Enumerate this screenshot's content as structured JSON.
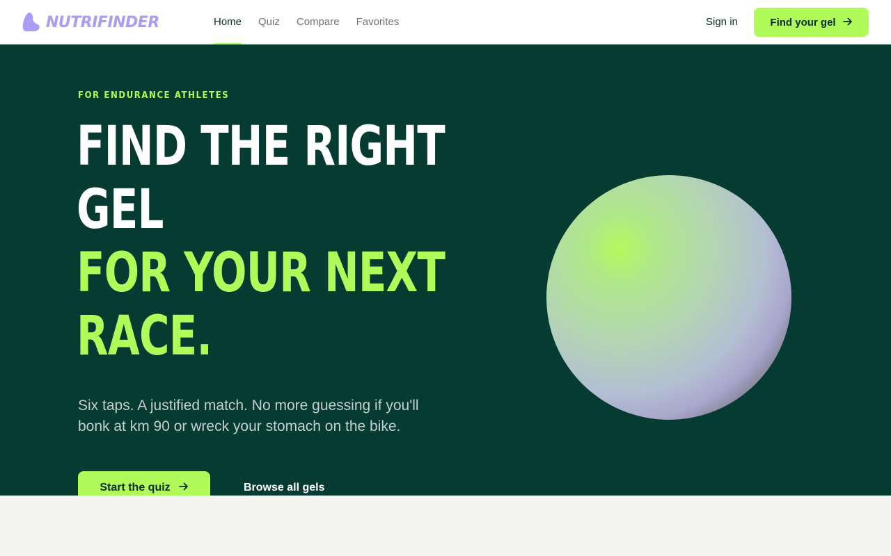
{
  "nav": {
    "brand": "NUTRIFINDER",
    "links": [
      {
        "label": "Home",
        "active": true
      },
      {
        "label": "Quiz",
        "active": false
      },
      {
        "label": "Compare",
        "active": false
      },
      {
        "label": "Favorites",
        "active": false
      }
    ],
    "signin_label": "Sign in",
    "cta_label": "Find your gel"
  },
  "hero": {
    "eyebrow": "FOR ENDURANCE ATHLETES",
    "headline_lines": [
      "FIND THE RIGHT",
      "GEL",
      "FOR YOUR NEXT",
      "RACE."
    ],
    "subcopy": "Six taps. A justified match. No more guessing if you'll bonk at km 90 or wreck your stomach on the bike.",
    "primary_cta": "Start the quiz",
    "secondary_cta": "Browse all gels"
  },
  "icons": {
    "logo": "drop-blob-icon",
    "cta_arrow": "arrow-right-icon"
  },
  "colors": {
    "accent": "#b0fa5a",
    "hero_bg": "#063b31",
    "brand_purple": "#ad9cf4",
    "ink": "#0a2b22"
  }
}
